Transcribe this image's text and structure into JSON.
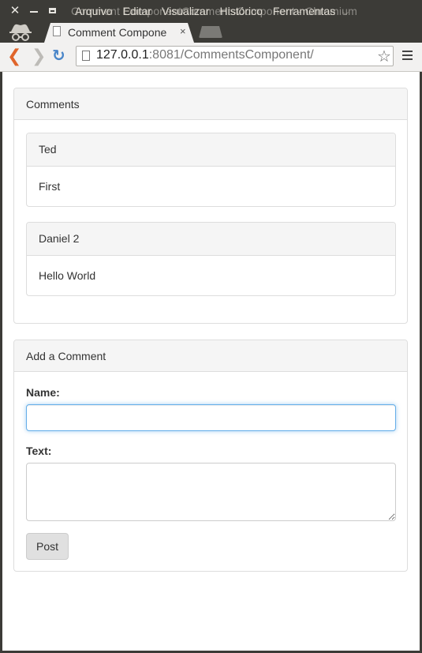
{
  "window": {
    "ghost_title": "Comment ComponentCommentsComponent - Chromium",
    "menu": [
      "Arquivo",
      "Editar",
      "Visualizar",
      "Histórico",
      "Ferramentas"
    ]
  },
  "tab": {
    "title": "Comment Compone",
    "close": "×"
  },
  "toolbar": {
    "url_host": "127.0.0.1",
    "url_rest": ":8081/CommentsComponent/"
  },
  "comments_panel": {
    "heading": "Comments",
    "comments": [
      {
        "author": "Ted",
        "text": "First"
      },
      {
        "author": "Daniel 2",
        "text": "Hello World"
      }
    ]
  },
  "form_panel": {
    "heading": "Add a Comment",
    "name_label": "Name:",
    "name_value": "",
    "text_label": "Text:",
    "text_value": "",
    "post_label": "Post"
  },
  "colors": {
    "chrome_dark": "#3c3b37",
    "back_arrow": "#e0652b",
    "reload": "#4a86c9",
    "focus_ring": "#66afe9"
  }
}
